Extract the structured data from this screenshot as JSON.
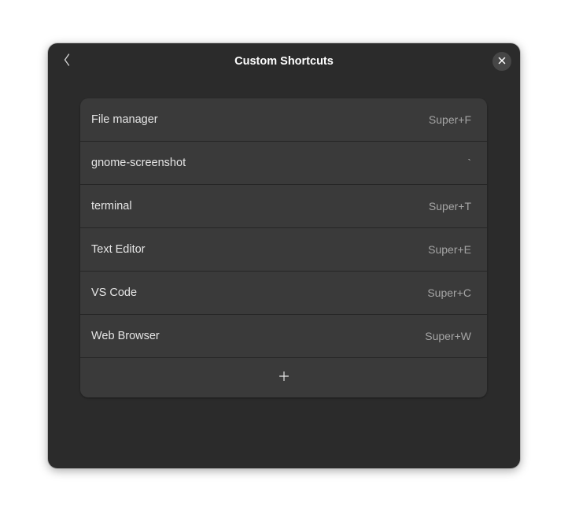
{
  "window": {
    "title": "Custom Shortcuts"
  },
  "header": {
    "back_icon": "go-back-icon",
    "close_icon": "close-icon"
  },
  "shortcuts": [
    {
      "name": "File manager",
      "accel": "Super+F"
    },
    {
      "name": "gnome-screenshot",
      "accel": "`"
    },
    {
      "name": "terminal",
      "accel": "Super+T"
    },
    {
      "name": "Text Editor",
      "accel": "Super+E"
    },
    {
      "name": "VS Code",
      "accel": "Super+C"
    },
    {
      "name": "Web Browser",
      "accel": "Super+W"
    }
  ],
  "add_button": {
    "icon": "add-icon"
  },
  "colors": {
    "window_bg": "#2b2b2b",
    "list_bg": "#3a3a3a",
    "text": "#e6e6e6",
    "accel_text": "#a5a5a5"
  }
}
